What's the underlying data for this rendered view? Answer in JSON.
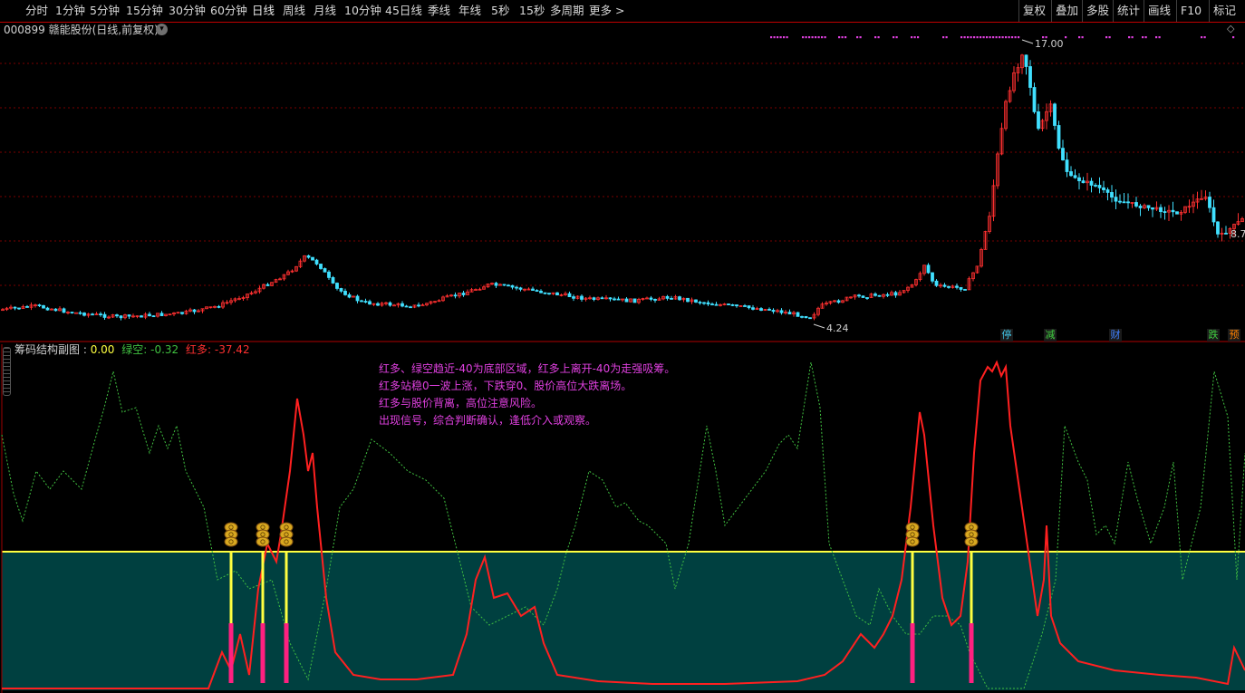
{
  "toolbar": {
    "tabs": [
      "分时",
      "1分钟",
      "5分钟",
      "15分钟",
      "30分钟",
      "60分钟",
      "日线",
      "周线",
      "月线",
      "10分钟",
      "45日线",
      "季线",
      "年线",
      "5秒",
      "15秒",
      "多周期",
      "更多 >"
    ],
    "active_tab": "日线",
    "right_tools": [
      "复权",
      "叠加",
      "多股",
      "统计",
      "画线",
      "F10",
      "标记"
    ]
  },
  "stock": {
    "title": "000899 赣能股份(日线,前复权)"
  },
  "main_chart": {
    "price_high_label": "17.00",
    "price_low_label": "4.24",
    "price_right_label": "8.7",
    "tags": [
      {
        "text": "停",
        "color": "#40c0e0"
      },
      {
        "text": "减",
        "color": "#40d040"
      },
      {
        "text": "财",
        "color": "#4080ff"
      },
      {
        "text": "跌",
        "color": "#40d040"
      },
      {
        "text": "预",
        "color": "#ff8000"
      }
    ],
    "colors": {
      "up": "#ff3030",
      "down": "#40e0ff",
      "grid": "#7a0000",
      "marker": "#e040e0"
    }
  },
  "sub_chart": {
    "name": "筹码结构副图",
    "value_label": "0.00",
    "green_label": "绿空:",
    "green_value": "-0.32",
    "red_label": "红多:",
    "red_value": "-37.42",
    "notes": [
      "红多、绿空趋近-40为底部区域，红多上离开-40为走强吸筹。",
      "红多站稳0一波上涨，下跌穿0、股价高位大跌离场。",
      "红多与股价背离，高位注意风险。",
      "出现信号，综合判断确认，逢低介入或观察。"
    ],
    "colors": {
      "red_line": "#ff2020",
      "green_line": "#40c040",
      "zero_line": "#ffff40",
      "fill": "#004040",
      "signal": "#ff2080"
    }
  }
}
